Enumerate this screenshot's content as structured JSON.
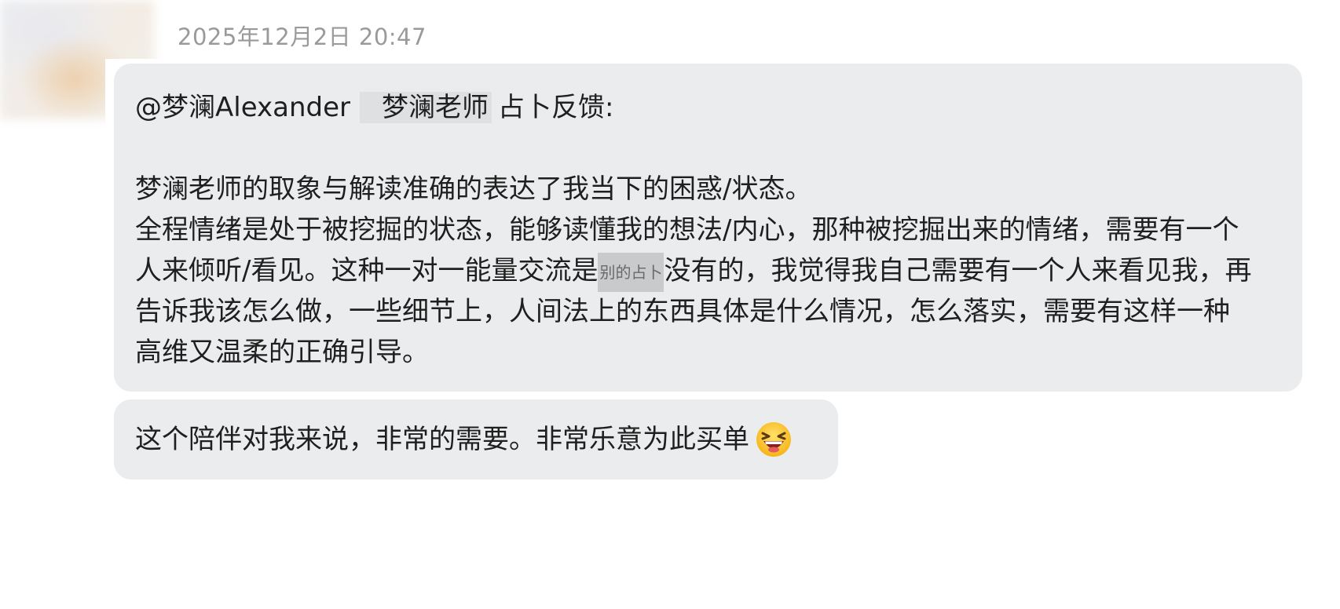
{
  "message": {
    "timestamp": "2025年12月2日 20:47",
    "bubble1": {
      "mention": "@梦澜Alexander",
      "mention_name": "梦澜老师",
      "mention_suffix": "占卜反馈:",
      "line1": "梦澜老师的取象与解读准确的表达了我当下的困惑/状态。",
      "line2": "全程情绪是处于被挖掘的状态，能够读懂我的想法/内心，那种被挖掘出来的情绪，需要有一个",
      "line3_a": "人来倾听/看见。这种一对一能量交流是",
      "line3_redacted": "别的占卜",
      "line3_b": "没有的，我觉得我自己需要有一个人来看见我，再",
      "line4": "告诉我该怎么做，一些细节上，人间法上的东西具体是什么情况，怎么落实，需要有这样一种",
      "line5": "高维又温柔的正确引导。"
    },
    "bubble2": {
      "text": "这个陪伴对我来说，非常的需要。非常乐意为此买单",
      "emoji": "laughing-face-emoji"
    }
  }
}
